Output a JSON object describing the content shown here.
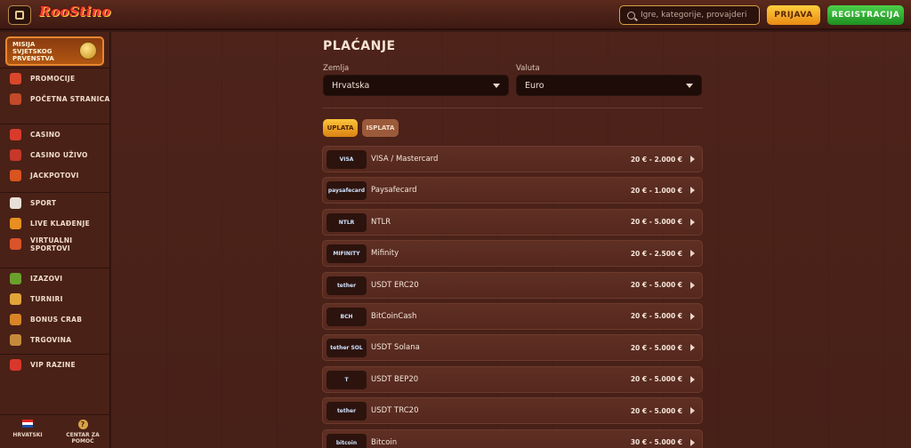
{
  "header": {
    "logo_text": "RooStino",
    "search_placeholder": "Igre, kategorije, provajderi",
    "login_label": "PRIJAVA",
    "register_label": "REGISTRACIJA"
  },
  "sidebar": {
    "mission": {
      "line1": "MISIJA",
      "line2": "SVJETSKOG",
      "line3": "PRVENSTVA"
    },
    "groups": [
      [
        {
          "label": "PROMOCIJE",
          "color": "#d9472b"
        },
        {
          "label": "POČETNA STRANICA",
          "color": "#c24a2a"
        }
      ],
      [
        {
          "label": "CASINO",
          "color": "#d83b2c"
        },
        {
          "label": "CASINO UŽIVO",
          "color": "#c7372a"
        },
        {
          "label": "JACKPOTOVI",
          "color": "#d9541f"
        }
      ],
      [
        {
          "label": "SPORT",
          "color": "#e8e0d6"
        },
        {
          "label": "LIVE KLAĐENJE",
          "color": "#e8901f"
        },
        {
          "label": "VIRTUALNI SPORTOVI",
          "color": "#d9542a"
        }
      ],
      [
        {
          "label": "IZAZOVI",
          "color": "#6aa12e"
        },
        {
          "label": "TURNIRI",
          "color": "#e2a53a"
        },
        {
          "label": "BONUS CRAB",
          "color": "#d98527"
        },
        {
          "label": "TRGOVINA",
          "color": "#c68a3d"
        }
      ],
      [
        {
          "label": "VIP RAZINE",
          "color": "#d8372c"
        }
      ]
    ],
    "footer": {
      "language": "HRVATSKI",
      "help_line1": "CENTAR ZA",
      "help_line2": "POMOĆ"
    }
  },
  "payment": {
    "title": "PLAĆANJE",
    "country_label": "Zemlja",
    "country_value": "Hrvatska",
    "currency_label": "Valuta",
    "currency_value": "Euro",
    "tab_deposit": "UPLATA",
    "tab_withdraw": "ISPLATA",
    "methods": [
      {
        "logo": "VISA",
        "name": "VISA / Mastercard",
        "range": "20 € - 2.000 €"
      },
      {
        "logo": "paysafecard",
        "name": "Paysafecard",
        "range": "20 € - 1.000 €"
      },
      {
        "logo": "NTLR",
        "name": "NTLR",
        "range": "20 € - 5.000 €"
      },
      {
        "logo": "MIFINITY",
        "name": "Mifinity",
        "range": "20 € - 2.500 €"
      },
      {
        "logo": "tether",
        "name": "USDT ERC20",
        "range": "20 € - 5.000 €"
      },
      {
        "logo": "BCH",
        "name": "BitCoinCash",
        "range": "20 € - 5.000 €"
      },
      {
        "logo": "tether SOL",
        "name": "USDT Solana",
        "range": "20 € - 5.000 €"
      },
      {
        "logo": "T",
        "name": "USDT BEP20",
        "range": "20 € - 5.000 €"
      },
      {
        "logo": "tether",
        "name": "USDT TRC20",
        "range": "20 € - 5.000 €"
      },
      {
        "logo": "bitcoin",
        "name": "Bitcoin",
        "range": "30 € - 5.000 €"
      }
    ]
  }
}
